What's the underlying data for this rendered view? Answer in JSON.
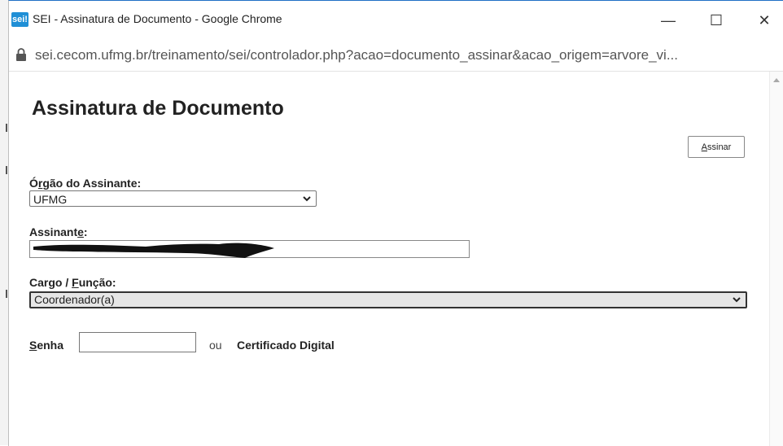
{
  "window": {
    "app_icon_text": "sei!",
    "title": "SEI - Assinatura de Documento - Google Chrome",
    "minimize_symbol": "—",
    "maximize_symbol": "☐",
    "close_symbol": "✕"
  },
  "address_bar": {
    "url": "sei.cecom.ufmg.br/treinamento/sei/controlador.php?acao=documento_assinar&acao_origem=arvore_vi..."
  },
  "page": {
    "title": "Assinatura de Documento",
    "assinar_button_first": "A",
    "assinar_button_rest": "ssinar"
  },
  "form": {
    "orgao": {
      "label_first": "Ó",
      "label_underlined": "r",
      "label_rest": "gão do Assinante:",
      "selected": "UFMG"
    },
    "assinante": {
      "label_first": "Assinant",
      "label_underlined": "e",
      "label_rest": ":",
      "value": ""
    },
    "cargo": {
      "label_first": "Cargo / ",
      "label_underlined": "F",
      "label_rest": "unção:",
      "selected": "Coordenador(a)"
    },
    "senha": {
      "label_underlined": "S",
      "label_rest": "enha",
      "value": ""
    },
    "ou_text": "ou",
    "certificado_text": "Certificado Digital"
  },
  "colors": {
    "accent": "#1f8fd6",
    "text": "#222222",
    "select_bg": "#e6e6e6"
  },
  "icons": {
    "lock": "lock-icon",
    "chevron": "chevron-down-icon",
    "scroll_up": "scroll-up-arrow-icon"
  }
}
